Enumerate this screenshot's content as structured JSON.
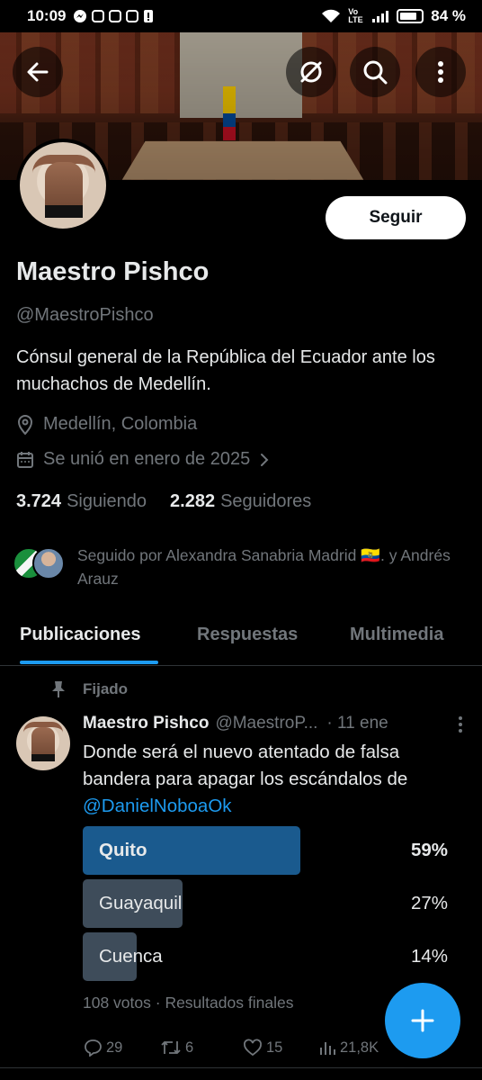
{
  "status_bar": {
    "time": "10:09",
    "network": "Vo LTE",
    "battery": "84 %"
  },
  "profile": {
    "name": "Maestro Pishco",
    "handle": "@MaestroPishco",
    "bio": "Cónsul general de la República del Ecuador ante los muchachos de Medellín.",
    "location": "Medellín, Colombia",
    "joined": "Se unió en enero de 2025",
    "following_count": "3.724",
    "following_label": "Siguiendo",
    "followers_count": "2.282",
    "followers_label": "Seguidores",
    "followed_by": "Seguido por Alexandra Sanabria Madrid 🇪🇨. y Andrés Arauz",
    "follow_button": "Seguir"
  },
  "tabs": [
    "Publicaciones",
    "Respuestas",
    "Multimedia"
  ],
  "pinned_tweet": {
    "pinned_label": "Fijado",
    "author_name": "Maestro Pishco",
    "author_handle": "@MaestroP...",
    "date": "· 11 ene",
    "text_before": "Donde será el nuevo atentado de falsa bandera para apagar los escándalos de ",
    "mention": "@DanielNoboaOk",
    "poll": {
      "options": [
        {
          "label": "Quito",
          "percent": "59%",
          "fraction": 0.59,
          "winner": true
        },
        {
          "label": "Guayaquil",
          "percent": "27%",
          "fraction": 0.27,
          "winner": false
        },
        {
          "label": "Cuenca",
          "percent": "14%",
          "fraction": 0.14,
          "winner": false
        }
      ],
      "meta": "108 votos · Resultados finales"
    },
    "actions": {
      "replies": "29",
      "reposts": "6",
      "likes": "15",
      "views": "21,8K"
    }
  },
  "colors": {
    "accent": "#1d9bf0",
    "poll_winner": "#1a5a8e",
    "poll_other": "#3e4c5a",
    "muted": "#71767b"
  }
}
